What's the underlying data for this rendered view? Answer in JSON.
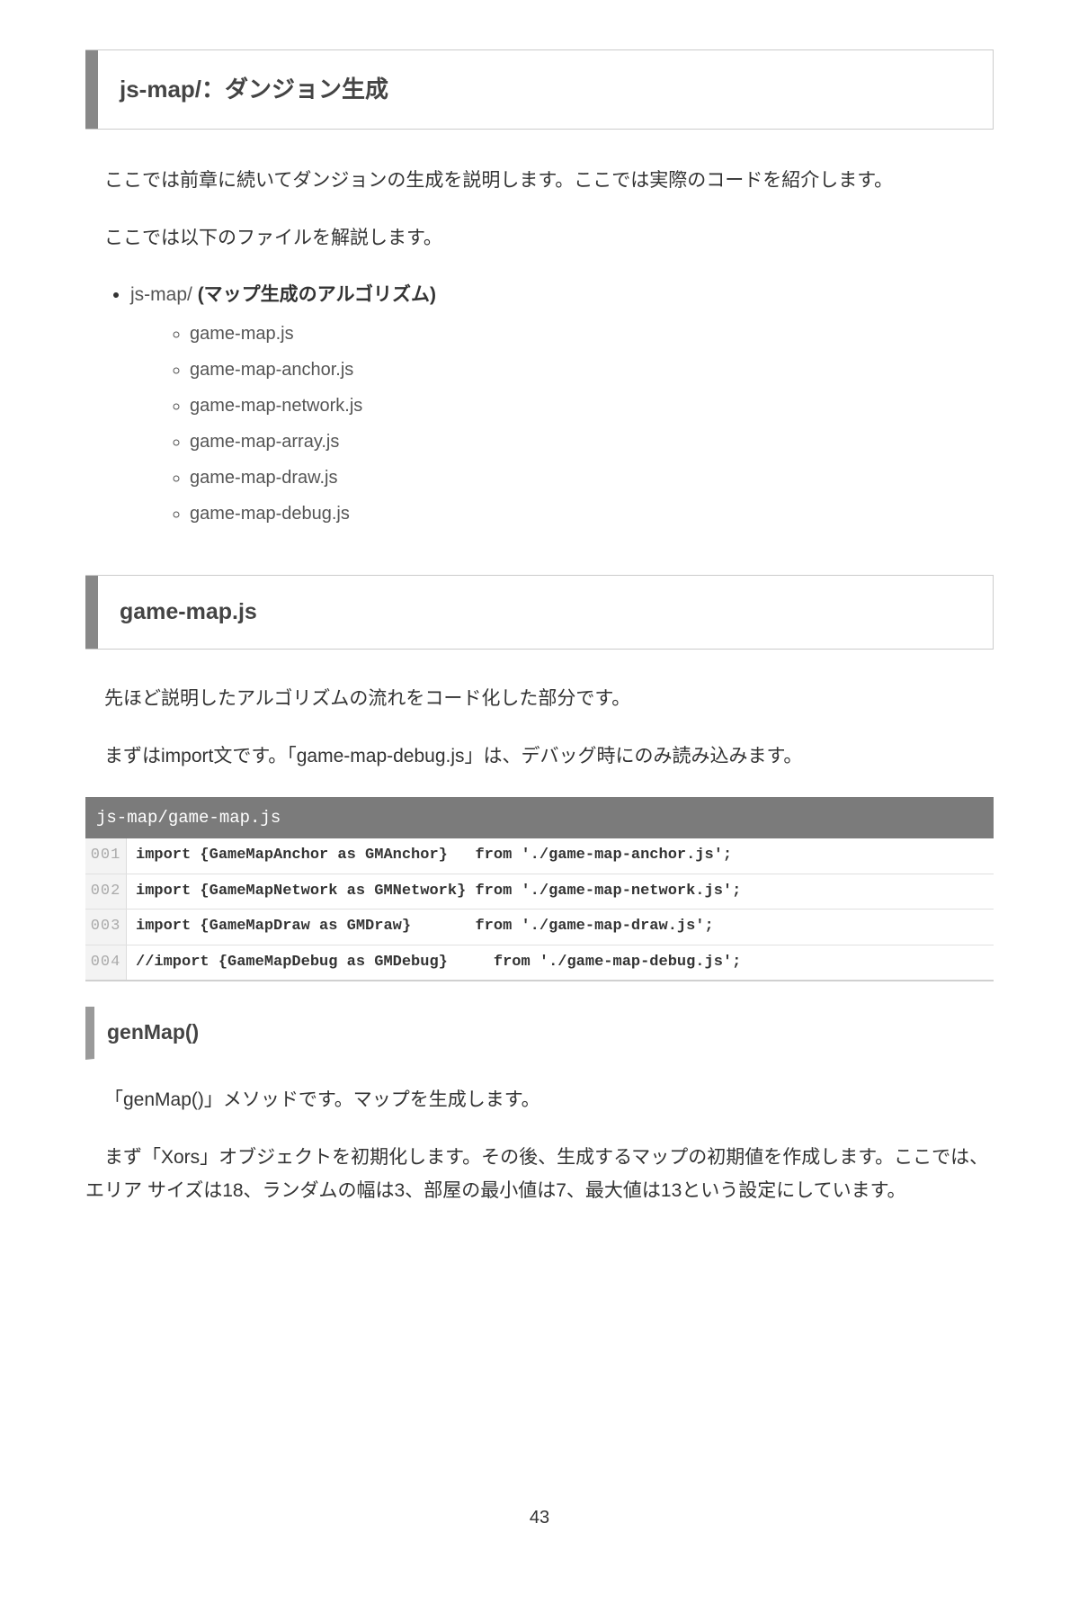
{
  "h1": "js-map/：ダンジョン生成",
  "intro_p1": "ここでは前章に続いてダンジョンの生成を説明します。ここでは実際のコードを紹介します。",
  "intro_p2": "ここでは以下のファイルを解説します。",
  "list_item_title_prefix": "js-map/ ",
  "list_item_title_bold": "(マップ生成のアルゴリズム)",
  "file_list": [
    "game-map.js",
    "game-map-anchor.js",
    "game-map-network.js",
    "game-map-array.js",
    "game-map-draw.js",
    "game-map-debug.js"
  ],
  "h2": "game-map.js",
  "sec2_p1": "先ほど説明したアルゴリズムの流れをコード化した部分です。",
  "sec2_p2": "まずはimport文です。「game-map-debug.js」は、デバッグ時にのみ読み込みます。",
  "code_header": "js-map/game-map.js",
  "code_lines": [
    {
      "n": "001",
      "t": "import {GameMapAnchor as GMAnchor}   from './game-map-anchor.js';"
    },
    {
      "n": "002",
      "t": "import {GameMapNetwork as GMNetwork} from './game-map-network.js';"
    },
    {
      "n": "003",
      "t": "import {GameMapDraw as GMDraw}       from './game-map-draw.js';"
    },
    {
      "n": "004",
      "t": "//import {GameMapDebug as GMDebug}     from './game-map-debug.js';"
    }
  ],
  "h3": "genMap()",
  "sec3_p1": "「genMap()」メソッドです。マップを生成します。",
  "sec3_p2": "まず「Xors」オブジェクトを初期化します。その後、生成するマップの初期値を作成します。ここでは、エリア サイズは18、ランダムの幅は3、部屋の最小値は7、最大値は13という設定にしています。",
  "page_number": "43"
}
